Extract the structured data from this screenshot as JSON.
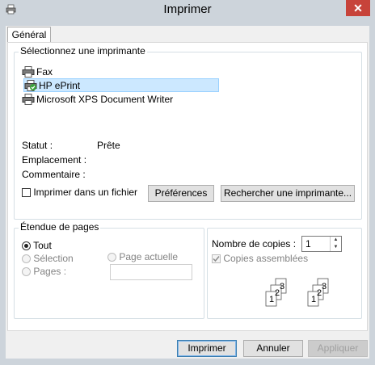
{
  "window": {
    "title": "Imprimer",
    "close_glyph": "✕"
  },
  "tabs": [
    {
      "label": "Général"
    }
  ],
  "printer_group": {
    "title": "Sélectionnez une imprimante",
    "printers": [
      {
        "name": "Fax",
        "icon": "fax-printer-icon"
      },
      {
        "name": "HP ePrint",
        "icon": "default-printer-icon",
        "selected": true
      },
      {
        "name": "Microsoft XPS Document Writer",
        "icon": "printer-icon"
      }
    ],
    "status_label": "Statut :",
    "status_value": "Prête",
    "location_label": "Emplacement :",
    "comment_label": "Commentaire :",
    "print_to_file_label": "Imprimer dans un fichier",
    "preferences_label": "Préférences",
    "find_printer_label": "Rechercher une imprimante..."
  },
  "page_range": {
    "title": "Étendue de pages",
    "all_label": "Tout",
    "selection_label": "Sélection",
    "current_page_label": "Page actuelle",
    "pages_label": "Pages :",
    "pages_value": ""
  },
  "copies": {
    "count_label": "Nombre de copies :",
    "count_value": "1",
    "collate_label": "Copies assemblées",
    "collate_checked": true
  },
  "buttons": {
    "print": "Imprimer",
    "cancel": "Annuler",
    "apply": "Appliquer"
  },
  "colors": {
    "titlebar": "#cdd4db",
    "close": "#c7433a",
    "selection": "#cce8ff"
  }
}
